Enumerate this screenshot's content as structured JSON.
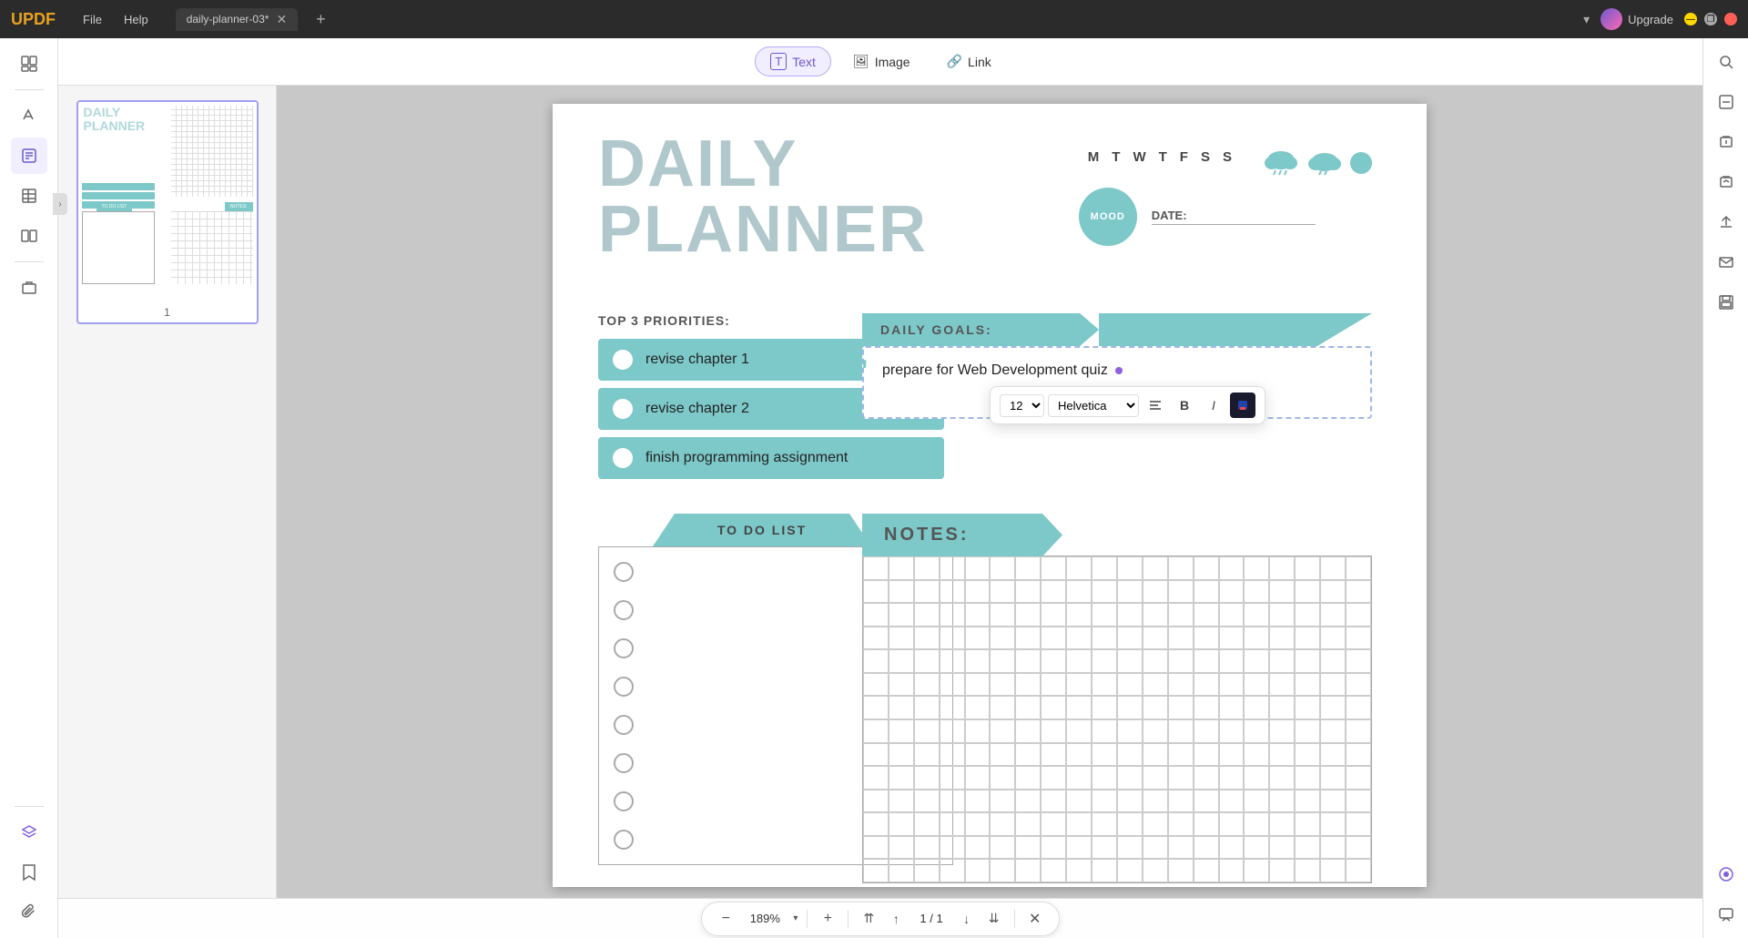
{
  "app": {
    "logo": "UPDF",
    "menu": [
      "File",
      "Help"
    ],
    "tab_name": "daily-planner-03*",
    "upgrade_label": "Upgrade"
  },
  "toolbar": {
    "text_label": "Text",
    "image_label": "Image",
    "link_label": "Link"
  },
  "thumbnail": {
    "page_num": "1"
  },
  "planner": {
    "title_line1": "DAILY",
    "title_line2": "PLANNER",
    "priorities_label": "TOP 3 PRIORITIES:",
    "priority1": "revise chapter 1",
    "priority2": "revise chapter 2",
    "priority3": "finish programming assignment",
    "mood_label": "MOOD",
    "date_label": "DATE:",
    "days": [
      "M",
      "T",
      "W",
      "T",
      "F",
      "S",
      "S"
    ],
    "daily_goals_label": "DAILY GOALS:",
    "goals_text": "prepare for Web Development quiz",
    "todo_label": "TO DO LIST",
    "notes_label": "NOTES:"
  },
  "format_toolbar": {
    "font_size": "12",
    "font_name": "Helvetica",
    "align_icon": "align",
    "bold_label": "B",
    "italic_label": "I",
    "color_icon": "color"
  },
  "zoom": {
    "level": "189%",
    "page_current": "1",
    "page_total": "1",
    "separator": "/",
    "minus_label": "−",
    "plus_label": "+"
  },
  "search_icon": "search",
  "icons": {
    "thumbnail": "📄",
    "paint": "🖌",
    "edit": "✏",
    "table": "⊞",
    "chart": "📊",
    "compare": "⧉",
    "layers": "◈",
    "bookmark": "🔖",
    "paperclip": "📎",
    "right_icon1": "⬛",
    "right_icon2": "🔒",
    "right_icon3": "🔒",
    "right_icon4": "↑",
    "right_icon5": "✉",
    "right_icon6": "💾"
  }
}
